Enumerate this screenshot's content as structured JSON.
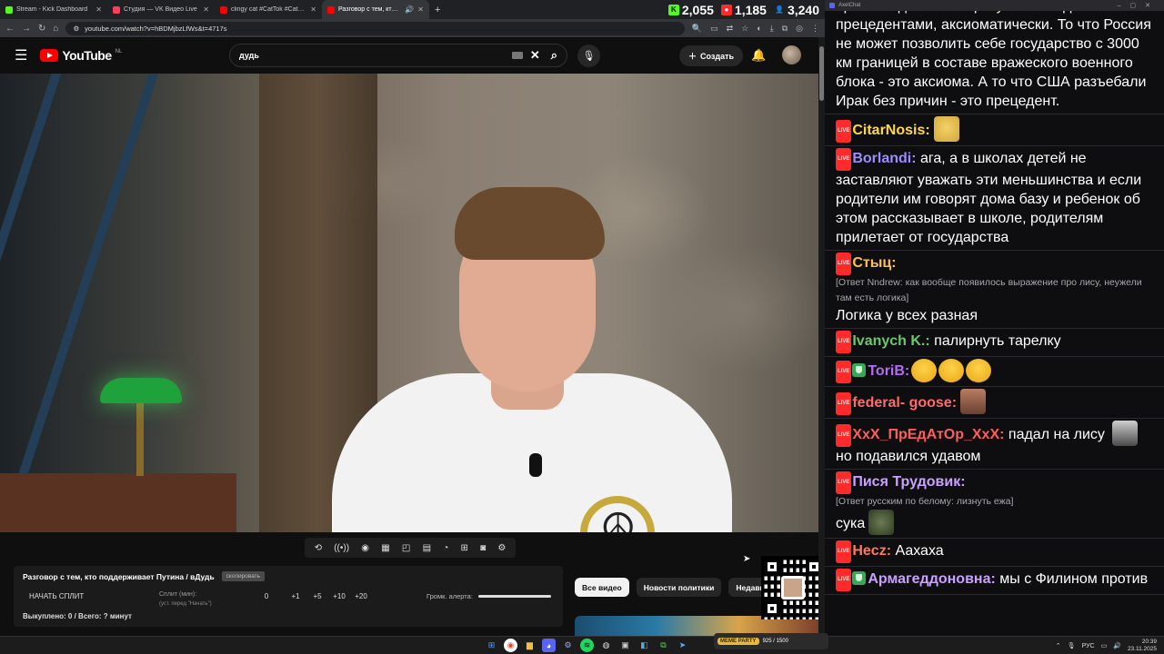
{
  "browser": {
    "tabs": [
      {
        "label": "Stream - Kick Dashboard",
        "color": "#53fc18",
        "active": false
      },
      {
        "label": "Студия — VK Видео Live",
        "color": "#ff3b5c",
        "active": false
      },
      {
        "label": "clingy cat #CatTok #CatFails20...",
        "color": "#ff0000",
        "active": false
      },
      {
        "label": "Разговор с тем, кто подде...",
        "color": "#ff0000",
        "active": true
      }
    ],
    "new_tab": "+",
    "url": "youtube.com/watch?v=hBDMjbzLfWs&t=4717s"
  },
  "stream_stats": {
    "kick": "2,055",
    "vk": "1,185",
    "viewers": "3,240"
  },
  "youtube": {
    "logo_text": "YouTube",
    "region": "NL",
    "search_query": "дудь",
    "create_label": "Создать",
    "chips": [
      "Все видео",
      "Новости политики",
      "Недавно"
    ]
  },
  "splits": {
    "title": "Разговор с тем, кто поддерживает Путина / вДудь",
    "badge": "скопировать",
    "start_label": "НАЧАТЬ СПЛИТ",
    "split_label": "Сплит (мин):",
    "split_hint": "(уст. перед \"Начать\")",
    "values": [
      "0",
      "+1",
      "+5",
      "+10",
      "+20"
    ],
    "volume_label": "Громк. алерта:",
    "footer": "Выкуплено: 0 / Всего: ? минут"
  },
  "chat": {
    "window_title": "AxelChat",
    "live_badge": "LIVE",
    "messages": [
      {
        "name": "",
        "color": "#ffffff",
        "text": "правые адекватные разумные люди мыслят прецедентами, аксиоматически. То что Россия не может позволить себе государство с 3000 км границей в составе вражеского военного блока - это аксиома. А то что США разъебали Ирак без причин - это прецедент.",
        "live": false
      },
      {
        "name": "CitarNosis:",
        "color": "#ffd84a",
        "text": "",
        "emote": "smug",
        "live": true
      },
      {
        "name": "Borlandi:",
        "color": "#9b8cff",
        "text": " ага, а в школах детей не заставляют уважать эти меньшинства и если родители им говорят дома базу и ребенок об этом рассказывает в школе, родителям прилетает от государства",
        "live": true
      },
      {
        "name": "Стыц:",
        "color": "#ffc04a",
        "reply": "[Ответ Nndrew: как вообще появилось выражение про лису, неужели там есть логика]",
        "text": "Логика у всех разная",
        "live": true
      },
      {
        "name": "Ivanych K.:",
        "color": "#6cc76c",
        "text": " палирнуть тарелку",
        "live": true
      },
      {
        "name": "ToriB:",
        "color": "#b36cf0",
        "text": "",
        "emote": "laugh3",
        "live": true,
        "shield": true
      },
      {
        "name": "federal- goose:",
        "color": "#ff6a6a",
        "text": "",
        "emote": "face",
        "live": true
      },
      {
        "name": "XxX_ПрЕдАтОр_XxX:",
        "color": "#ff5d5d",
        "text": " падал на лису ",
        "text2": "но подавился удавом",
        "emote": "mono",
        "live": true
      },
      {
        "name": "Пися Трудовик:",
        "color": "#c9a0ff",
        "reply": "[Ответ русским по белому: лизнуть ежа]",
        "text": "сука",
        "emote": "goblin",
        "live": true
      },
      {
        "name": "Hecz:",
        "color": "#ff7a5c",
        "text": " Аахаха",
        "live": true
      },
      {
        "name": "Армагеддоновна:",
        "color": "#c9a0ff",
        "text": " мы с Филином против",
        "live": true,
        "shield": true
      }
    ]
  },
  "taskbar": {
    "game_label": "MEME PARTY",
    "game_score": "925 / 1500",
    "lang": "РУС",
    "time": "20:39",
    "date": "23.11.2025"
  }
}
